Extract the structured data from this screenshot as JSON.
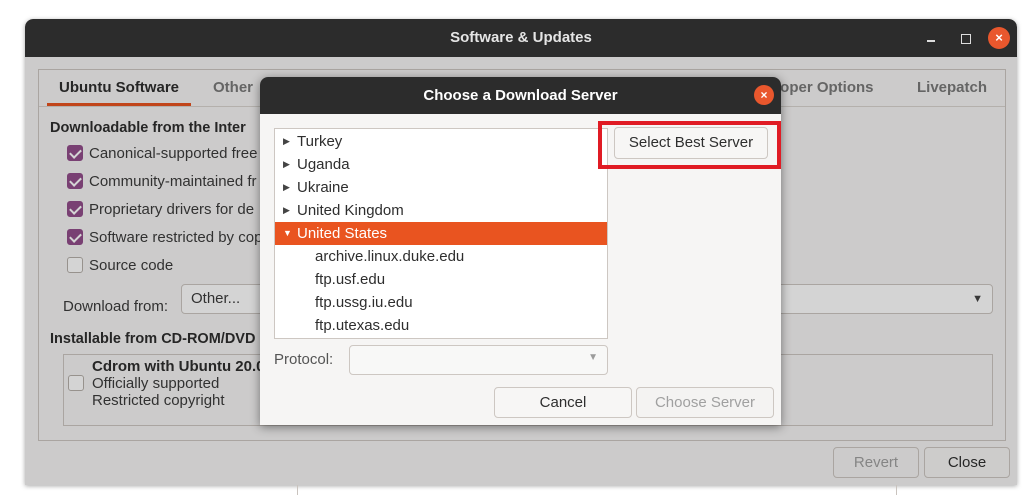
{
  "window": {
    "title": "Software & Updates",
    "close_glyph": "×"
  },
  "tabs": [
    {
      "label": "Ubuntu Software",
      "active": true
    },
    {
      "label": "Other",
      "active": false
    },
    {
      "label": "loper Options",
      "active": false
    },
    {
      "label": "Livepatch",
      "active": false
    }
  ],
  "ubuntu_software": {
    "downloadable_header": "Downloadable from the Inter",
    "options": [
      {
        "label": "Canonical-supported free",
        "checked": true
      },
      {
        "label": "Community-maintained fr",
        "checked": true
      },
      {
        "label": "Proprietary drivers for de",
        "checked": true
      },
      {
        "label": "Software restricted by cop",
        "checked": true
      },
      {
        "label": "Source code",
        "checked": false
      }
    ],
    "download_from_label": "Download from:",
    "download_from_value": "Other...",
    "cdrom_header": "Installable from CD-ROM/DVD",
    "cdrom": {
      "name": "Cdrom with Ubuntu 20.0",
      "line1": "Officially supported",
      "line2": "Restricted copyright",
      "checked": false
    }
  },
  "footer": {
    "revert_label": "Revert",
    "close_label": "Close"
  },
  "dialog": {
    "title": "Choose a Download Server",
    "close_glyph": "×",
    "countries": [
      {
        "label": "Turkey",
        "expanded": false
      },
      {
        "label": "Uganda",
        "expanded": false
      },
      {
        "label": "Ukraine",
        "expanded": false
      },
      {
        "label": "United Kingdom",
        "expanded": false
      },
      {
        "label": "United States",
        "expanded": true,
        "selected": true
      }
    ],
    "servers": [
      "archive.linux.duke.edu",
      "ftp.usf.edu",
      "ftp.ussg.iu.edu",
      "ftp.utexas.edu"
    ],
    "select_best_label": "Select Best Server",
    "protocol_label": "Protocol:",
    "protocol_value": "",
    "cancel_label": "Cancel",
    "choose_label": "Choose Server"
  },
  "colors": {
    "accent": "#e95420",
    "highlight": "#e01b24",
    "checkbox": "#924d8b"
  }
}
